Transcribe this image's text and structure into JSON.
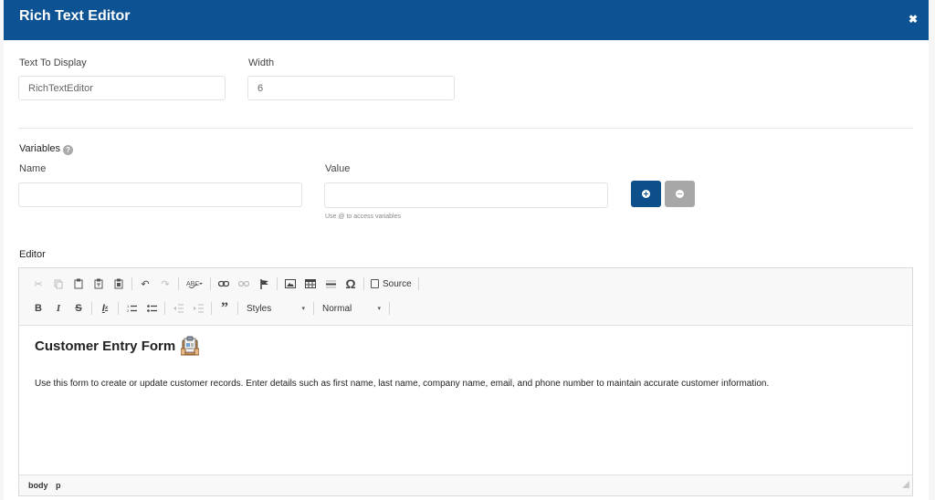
{
  "header": {
    "title": "Rich Text Editor",
    "close_label": "✖"
  },
  "fields": {
    "text_to_display": {
      "label": "Text To Display",
      "value": "RichTextEditor"
    },
    "width": {
      "label": "Width",
      "value": "6"
    }
  },
  "variables": {
    "title": "Variables",
    "help_icon": "?",
    "name_label": "Name",
    "value_label": "Value",
    "name_value": "",
    "value_value": "",
    "hint": "Use @ to access variables"
  },
  "editor": {
    "label": "Editor",
    "toolbar": {
      "source_label": "Source",
      "styles_label": "Styles",
      "format_label": "Normal"
    },
    "content": {
      "heading": "Customer Entry Form",
      "paragraph": "Use this form to create or update customer records. Enter details such as first name, last name, company name, email, and phone number to maintain accurate customer information."
    },
    "status_path": [
      "body",
      "p"
    ]
  },
  "colors": {
    "header": "#0d5394",
    "add_button": "#0d4f8b",
    "remove_button": "#a7a7a7"
  }
}
